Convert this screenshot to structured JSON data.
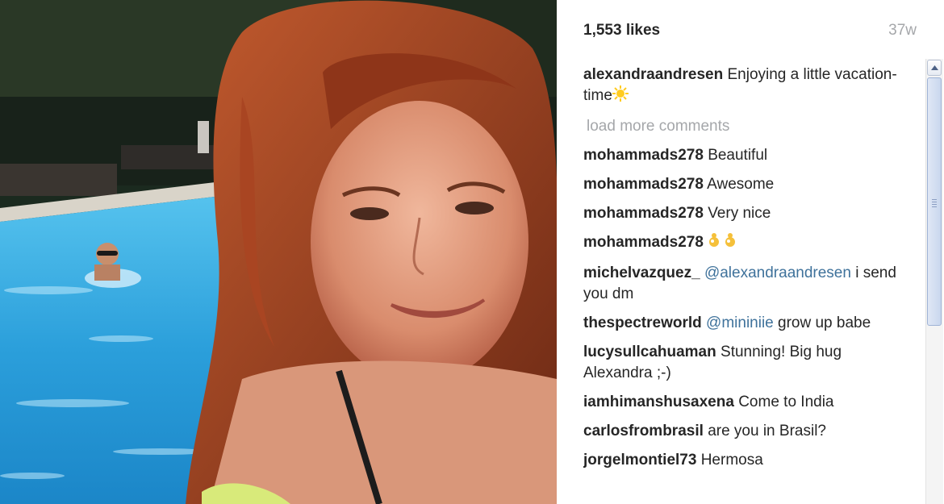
{
  "post": {
    "likes": "1,553 likes",
    "age": "37w",
    "caption": {
      "user": "alexandraandresen",
      "text": "Enjoying a little vacation-time",
      "emoji": "sun-emoji"
    },
    "load_more": "load more comments",
    "comments": [
      {
        "user": "mohammads278",
        "text": "Beautiful"
      },
      {
        "user": "mohammads278",
        "text": "Awesome"
      },
      {
        "user": "mohammads278",
        "text": "Very nice"
      },
      {
        "user": "mohammads278",
        "text": "",
        "emoji": "ok-hand-emoji-x2"
      },
      {
        "user": "michelvazquez_",
        "mention": "@alexandraandresen",
        "text": " i send you dm"
      },
      {
        "user": "thespectreworld",
        "mention": "@mininiie",
        "text": " grow up babe"
      },
      {
        "user": "lucysullcahuaman",
        "text": "Stunning! Big hug Alexandra ;-)"
      },
      {
        "user": "iamhimanshusaxena",
        "text": "Come to India"
      },
      {
        "user": "carlosfrombrasil",
        "text": "are you in Brasil?"
      },
      {
        "user": "jorgelmontiel73",
        "text": "Hermosa"
      }
    ]
  },
  "photo": {
    "subject": "selfie by a swimming pool",
    "accent_pool": "#2aa6e0",
    "accent_hair": "#9b3a1e"
  }
}
